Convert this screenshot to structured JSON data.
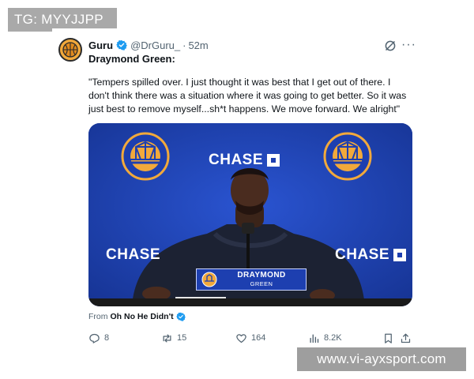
{
  "watermarks": {
    "top": "TG: MYYJJPP",
    "bottom": "www.vi-ayxsport.com"
  },
  "post": {
    "author": {
      "name": "Guru",
      "handle": "@DrGuru_",
      "separator": "·",
      "time": "52m",
      "verified": true
    },
    "headline": "Draymond Green:",
    "quote": "\"Tempers spilled over. I just thought it was best that I get out of there. I don't think there was a situation where it was going to get better. So it was just best to remove myself...sh*t happens. We move forward. We alright\"",
    "media": {
      "backdrop_texts": [
        "CHASE",
        "CHASE",
        "CHASE"
      ],
      "lower_third": {
        "name": "DRAYMOND",
        "team": "GREEN"
      }
    },
    "source": {
      "prefix": "From",
      "name": "Oh No He Didn't",
      "verified": true
    },
    "actions": {
      "replies": "8",
      "reposts": "15",
      "likes": "164",
      "views": "8.2K"
    }
  },
  "colors": {
    "verified_blue": "#1d9bf0",
    "backdrop_blue": "#1d3fb0",
    "warriors_gold": "#f2a93b",
    "muted_text": "#536471"
  },
  "icons": [
    "grok-icon",
    "more-icon",
    "reply-icon",
    "repost-icon",
    "like-icon",
    "views-icon",
    "bookmark-icon",
    "share-icon",
    "verified-icon"
  ]
}
